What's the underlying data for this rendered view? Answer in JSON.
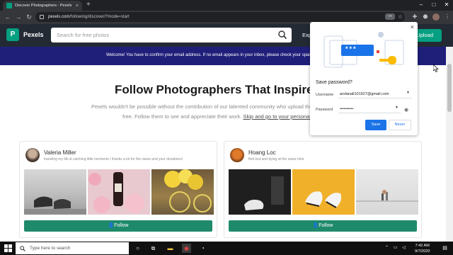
{
  "browser": {
    "tab_title": "Discover Photographers - Pexels",
    "tab_close": "×",
    "new_tab": "+",
    "url_host": "pexels.com",
    "url_path": "/following/discover/?mode=start",
    "key_badge": "⊶"
  },
  "pexels": {
    "brand": "Pexels",
    "logo_letter": "P",
    "search_placeholder": "Search for free photos",
    "explore": "Explore",
    "upload": "Upload"
  },
  "banner": {
    "text": "Welcome! You have to confirm your email address. If no email appears in your inbox, please check your spam folder."
  },
  "page": {
    "heading": "Follow Photographers That Inspire You",
    "sub_line1": "Pexels wouldn't be possible without the contribution of our talented community who upload their photos for",
    "sub_line2_text": "free. Follow them to see and appreciate their work.",
    "sub_line2_link": "Skip and go to your personal feed"
  },
  "cards": [
    {
      "name": "Valeria Miller",
      "bio": "traveling my life & catching little moments / thanks a lot for the views and your donations!",
      "follow": "Follow"
    },
    {
      "name": "Hoang Loc",
      "bio": "find lost and dying at the same time",
      "follow": "Follow"
    }
  ],
  "popup": {
    "close": "×",
    "title": "Save password?",
    "username_label": "Username",
    "username_value": "arslanali101927@gmail.com",
    "password_label": "Password",
    "password_value": "••••••••••",
    "save": "Save",
    "never": "Never",
    "badge_text": "***"
  },
  "taskbar": {
    "search_placeholder": "Type here to search",
    "time": "7:42 AM",
    "date": "9/7/2020"
  },
  "colors": {
    "pexels_green": "#05a081",
    "follow_green": "#1f8a6b",
    "banner_blue": "#1f1f7a",
    "chrome_blue": "#1a73e8"
  }
}
